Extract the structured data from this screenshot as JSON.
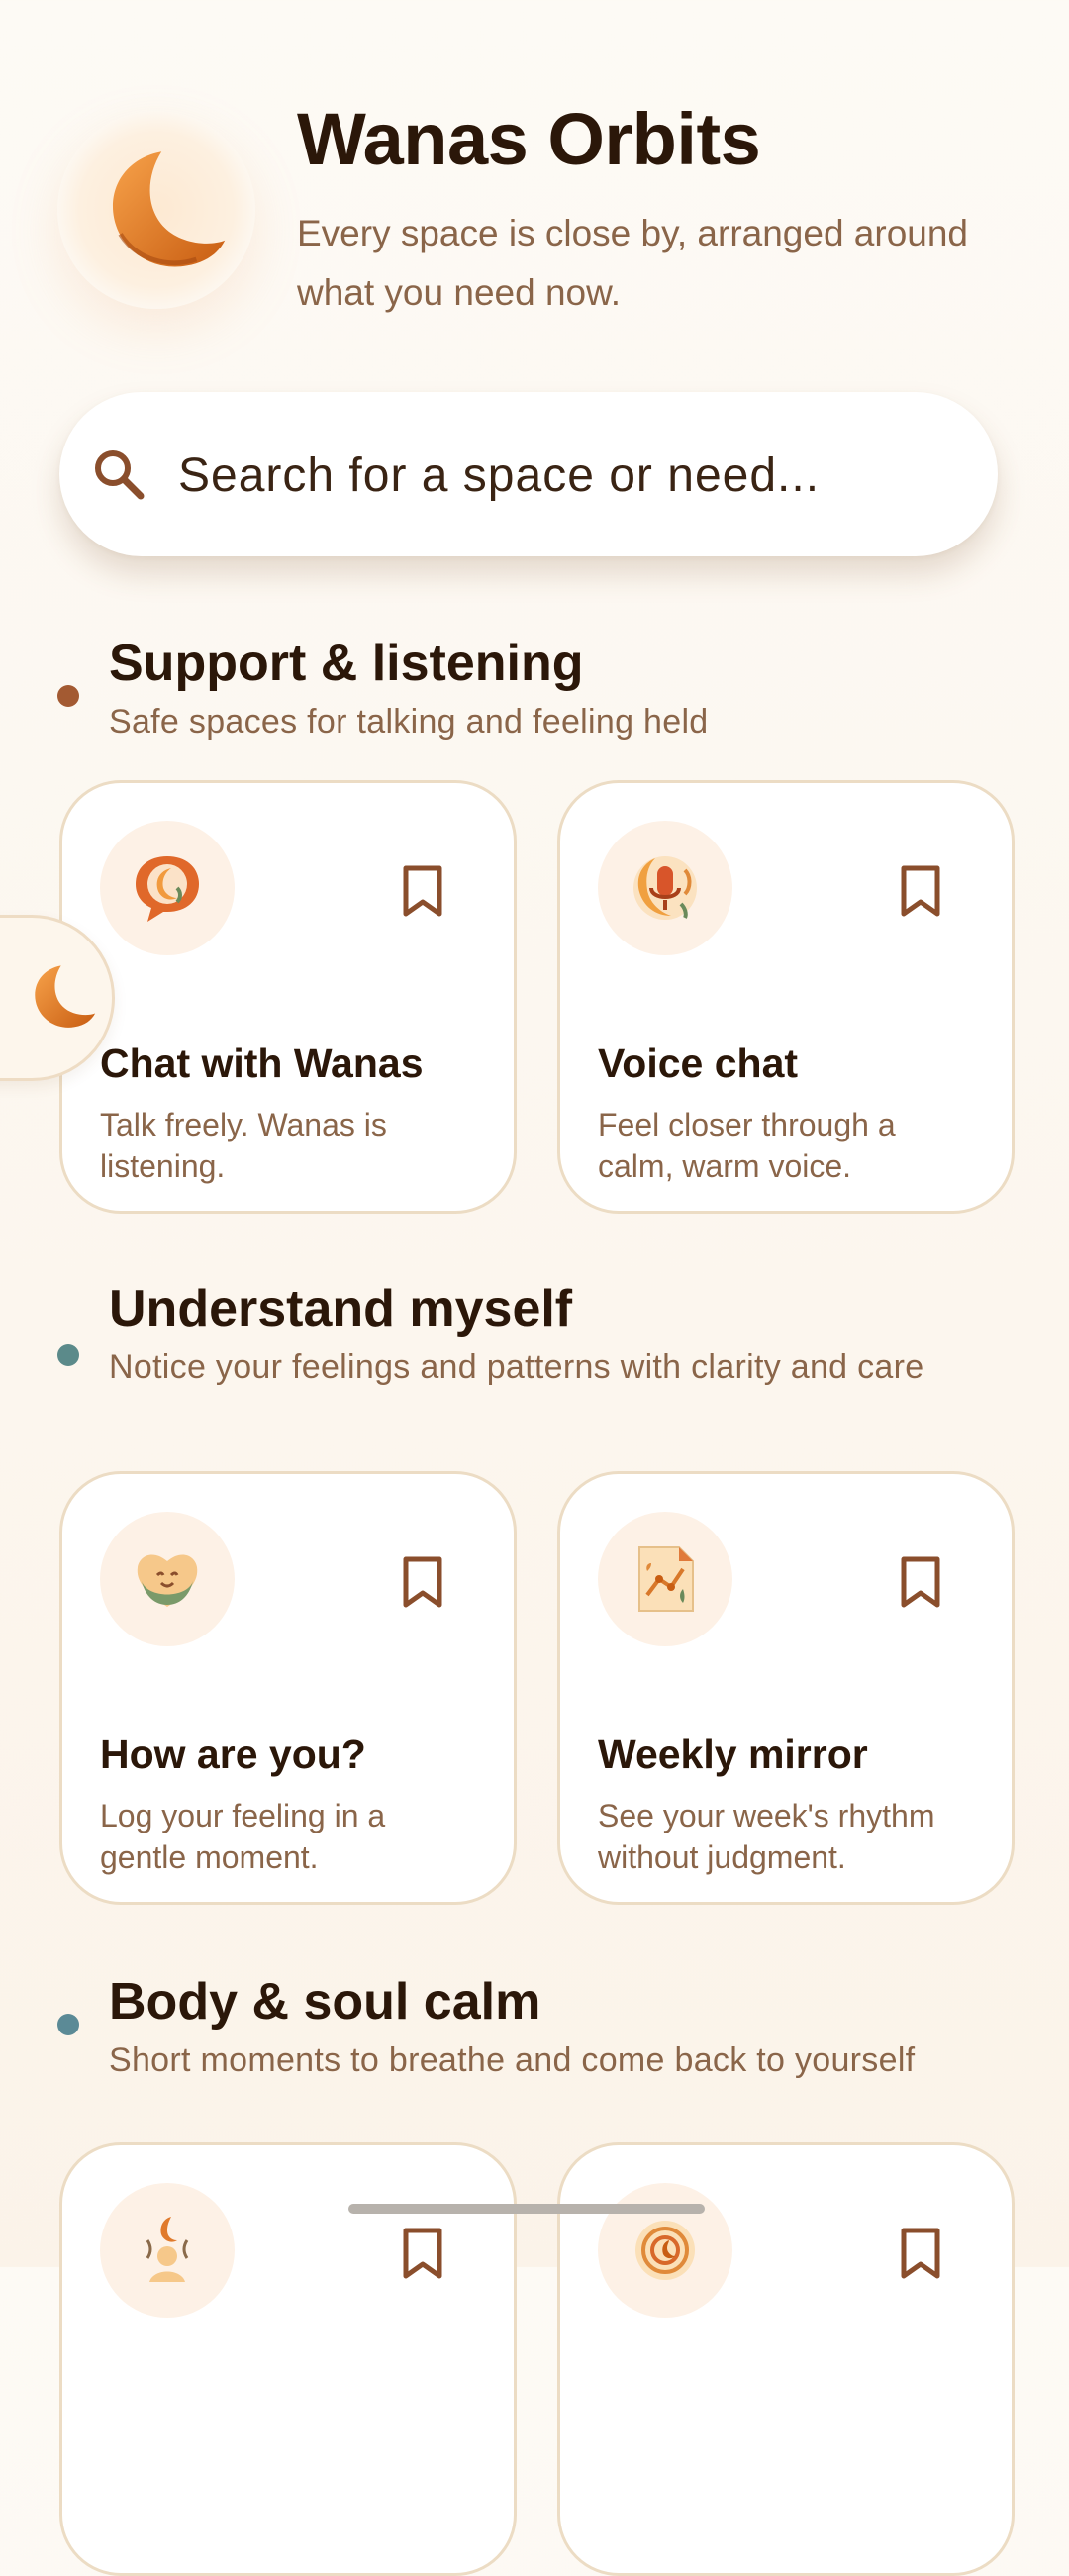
{
  "app": {
    "title": "Wanas Orbits",
    "subtitle": "Every space is close by, arranged around what you need now."
  },
  "search": {
    "placeholder": "Search for a space or need..."
  },
  "sections": [
    {
      "title": "Support & listening",
      "subtitle": "Safe spaces for talking and feeling held",
      "dot_color": "#a35a32",
      "cards": [
        {
          "title": "Chat with Wanas",
          "desc": "Talk freely. Wanas is listening.",
          "icon": "chat-bubble-moon-icon"
        },
        {
          "title": "Voice chat",
          "desc": "Feel closer through a calm, warm voice.",
          "icon": "microphone-moon-icon"
        }
      ]
    },
    {
      "title": "Understand myself",
      "subtitle": "Notice your feelings and patterns with clarity and care",
      "dot_color": "#5b8a8a",
      "cards": [
        {
          "title": "How are you?",
          "desc": "Log your feeling in a gentle moment.",
          "icon": "heart-smile-icon"
        },
        {
          "title": "Weekly mirror",
          "desc": "See your week's rhythm without judgment.",
          "icon": "chart-note-icon"
        }
      ]
    },
    {
      "title": "Body & soul calm",
      "subtitle": "Short moments to breathe and come back to yourself",
      "dot_color": "#5b8a96",
      "cards": [
        {
          "icon": "meditation-moon-icon"
        },
        {
          "icon": "breathing-circle-icon"
        }
      ]
    }
  ],
  "colors": {
    "accent": "#e07a2c",
    "text_primary": "#2b1709",
    "text_secondary": "#8a6549",
    "card_border": "#ecdcc4",
    "bookmark": "#8a4e2c"
  }
}
